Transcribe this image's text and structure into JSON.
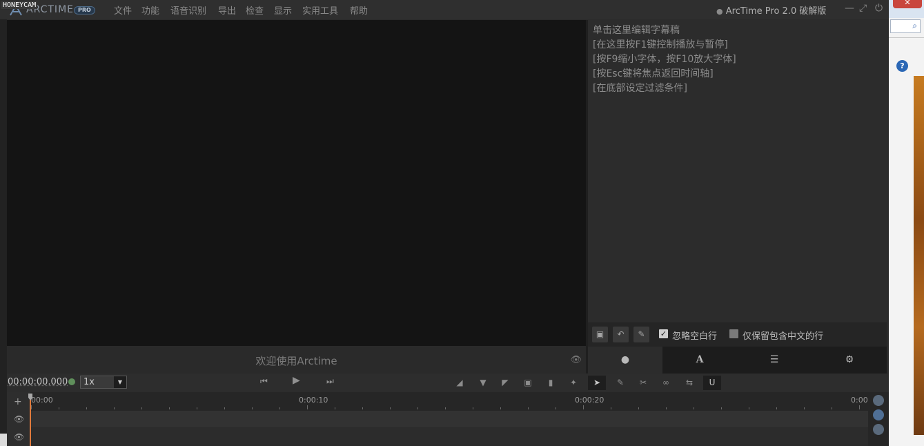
{
  "watermark": "HONEYCAM",
  "app": {
    "logo_text": "ARCTIME",
    "logo_badge": "PRO",
    "title": "ArcTime Pro 2.0 破解版"
  },
  "menu": [
    "文件",
    "功能",
    "语音识别",
    "导出",
    "检查",
    "显示",
    "实用工具",
    "帮助"
  ],
  "video": {
    "welcome": "欢迎使用Arctime"
  },
  "editor": {
    "hints": [
      "单击这里编辑字幕稿",
      "[在这里按F1键控制播放与暂停]",
      "[按F9缩小字体，按F10放大字体]",
      "[按Esc键将焦点返回时间轴]",
      "[在底部设定过滤条件]"
    ],
    "filters": {
      "ignore_blank_label": "忽略空白行",
      "ignore_blank_checked": true,
      "chinese_only_label": "仅保留包含中文的行",
      "chinese_only_checked": false
    },
    "tabs": [
      "comment-icon",
      "font-icon",
      "list-icon",
      "gear-icon"
    ],
    "active_tab": 0
  },
  "transport": {
    "timecode": "00:00:00.000",
    "speed": "1x"
  },
  "timeline": {
    "labels": [
      "00:00",
      "0:00:10",
      "0:00:20",
      "0:00:"
    ],
    "playhead_seconds": 0
  },
  "colors": {
    "playhead": "#e07a3c",
    "status_dot": "#5f8f5b"
  }
}
